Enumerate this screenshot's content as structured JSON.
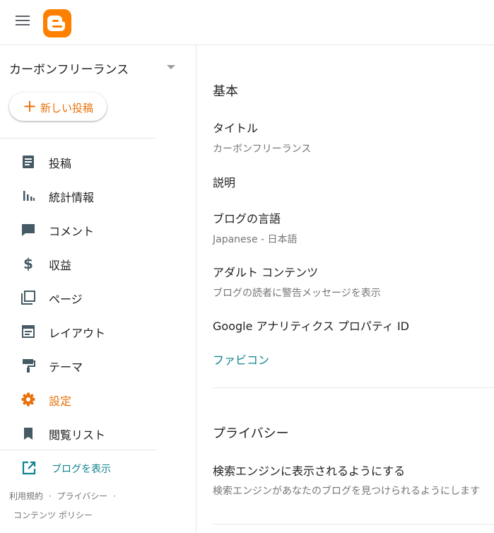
{
  "header": {
    "menu_icon": "hamburger-menu-icon",
    "logo_icon": "blogger-logo-icon",
    "brand_color": "#ff8000"
  },
  "sidebar": {
    "blog_name": "カーボンフリーランス",
    "new_post_label": "新しい投稿",
    "items": [
      {
        "label": "投稿",
        "icon": "posts-icon"
      },
      {
        "label": "統計情報",
        "icon": "stats-icon"
      },
      {
        "label": "コメント",
        "icon": "comment-icon"
      },
      {
        "label": "収益",
        "icon": "dollar-icon"
      },
      {
        "label": "ページ",
        "icon": "pages-icon"
      },
      {
        "label": "レイアウト",
        "icon": "layout-icon"
      },
      {
        "label": "テーマ",
        "icon": "theme-icon"
      },
      {
        "label": "設定",
        "icon": "gear-icon",
        "active": true
      },
      {
        "label": "閲覧リスト",
        "icon": "bookmark-icon"
      }
    ],
    "view_blog_label": "ブログを表示",
    "footer": {
      "terms": "利用規約",
      "sep1": "·",
      "privacy": "プライバシー",
      "sep2": "·",
      "content_policy": "コンテンツ ポリシー"
    },
    "active_color": "#e8710a",
    "link_color": "#0f838f"
  },
  "main": {
    "basic": {
      "title": "基本",
      "title_label": "タイトル",
      "title_value": "カーボンフリーランス",
      "description_label": "説明",
      "language_label": "ブログの言語",
      "language_value": "Japanese - 日本語",
      "adult_label": "アダルト コンテンツ",
      "adult_value": "ブログの読者に警告メッセージを表示",
      "analytics_label": "Google アナリティクス プロパティ ID",
      "favicon_label": "ファビコン"
    },
    "privacy": {
      "title": "プライバシー",
      "search_label": "検索エンジンに表示されるようにする",
      "search_value": "検索エンジンがあなたのブログを見つけられるようにします"
    }
  }
}
